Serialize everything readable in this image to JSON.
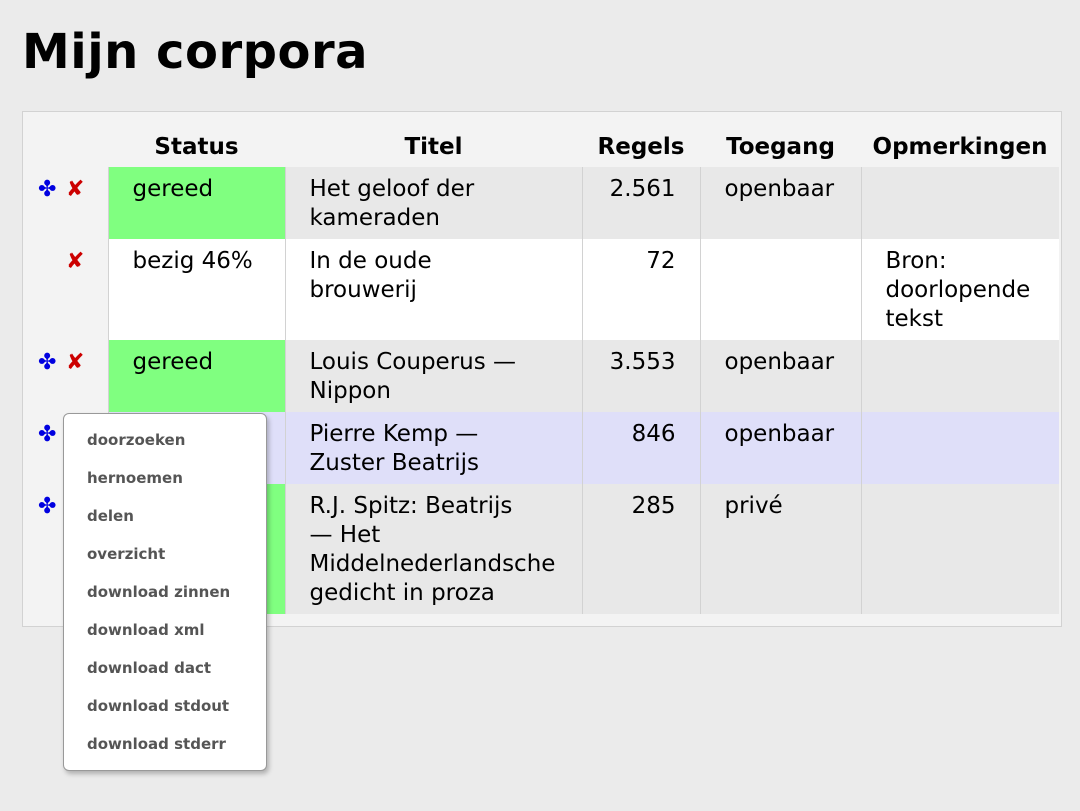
{
  "page": {
    "title": "Mijn corpora"
  },
  "table": {
    "headers": [
      "Status",
      "Titel",
      "Regels",
      "Toegang",
      "Opmerkingen"
    ],
    "rows": [
      {
        "status": "gereed",
        "title_lines": [
          "Het geloof der",
          "kameraden"
        ],
        "lines": "2.561",
        "access": "openbaar",
        "remarks_lines": []
      },
      {
        "status": "bezig 46%",
        "title_lines": [
          "In de oude",
          "brouwerij"
        ],
        "lines": "72",
        "access": "",
        "remarks_lines": [
          "Bron:",
          "doorlopende",
          "tekst"
        ]
      },
      {
        "status": "gereed",
        "title_lines": [
          "Louis Couperus —",
          "Nippon"
        ],
        "lines": "3.553",
        "access": "openbaar",
        "remarks_lines": []
      },
      {
        "status": "",
        "title_lines": [
          "Pierre Kemp —",
          "Zuster Beatrijs"
        ],
        "lines": "846",
        "access": "openbaar",
        "remarks_lines": []
      },
      {
        "status": "",
        "title_lines": [
          "R.J. Spitz: Beatrijs",
          "— Het",
          "Middelnederlandsche",
          "gedicht in proza"
        ],
        "lines": "285",
        "access": "privé",
        "remarks_lines": []
      }
    ],
    "icons": {
      "move": "✤",
      "delete": "✘"
    }
  },
  "context_menu": {
    "items": [
      "doorzoeken",
      "hernoemen",
      "delen",
      "overzicht",
      "download zinnen",
      "download xml",
      "download dact",
      "download stdout",
      "download stderr"
    ]
  },
  "colors": {
    "done": "#80ff80",
    "selected_row": "#dfdff9",
    "move_icon": "#0000e0",
    "delete_icon": "#cc0000"
  }
}
